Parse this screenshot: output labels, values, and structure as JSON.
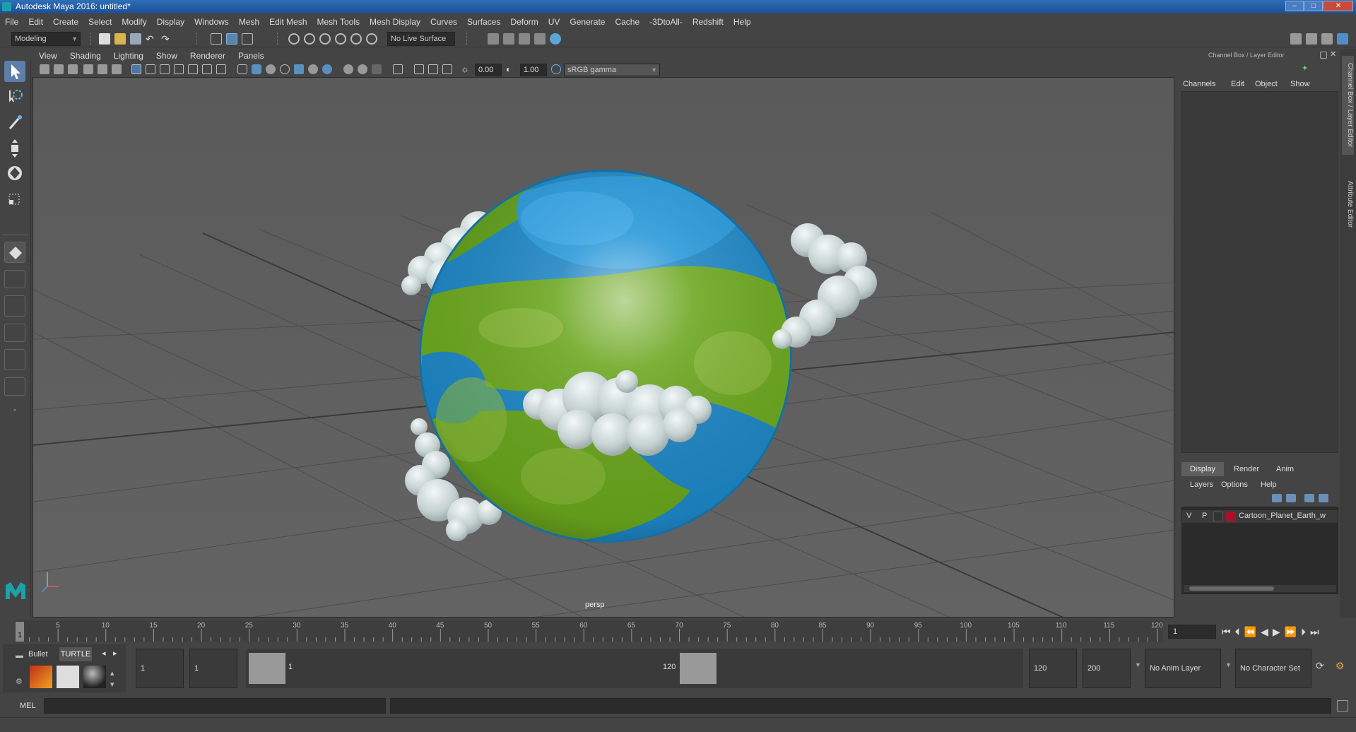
{
  "window": {
    "title": "Autodesk Maya 2016: untitled*",
    "min": "–",
    "max": "□",
    "close": "✕"
  },
  "menus": [
    "File",
    "Edit",
    "Create",
    "Select",
    "Modify",
    "Display",
    "Windows",
    "Mesh",
    "Edit Mesh",
    "Mesh Tools",
    "Mesh Display",
    "Curves",
    "Surfaces",
    "Deform",
    "UV",
    "Generate",
    "Cache",
    "-3DtoAll-",
    "Redshift",
    "Help"
  ],
  "status_line": {
    "mode": "Modeling",
    "live_surface": "No Live Surface"
  },
  "panel": {
    "menus": [
      "View",
      "Shading",
      "Lighting",
      "Show",
      "Renderer",
      "Panels"
    ],
    "exposure": "0.00",
    "gamma": "1.00",
    "color_space": "sRGB gamma",
    "camera": "persp"
  },
  "channel_box": {
    "title": "Channel Box / Layer Editor",
    "menus": [
      "Channels",
      "Edit",
      "Object",
      "Show"
    ],
    "layer_tabs": [
      "Display",
      "Render",
      "Anim"
    ],
    "layer_menus": [
      "Layers",
      "Options",
      "Help"
    ],
    "layer": {
      "v": "V",
      "p": "P",
      "name": "Cartoon_Planet_Earth_w",
      "color": "#a8102a"
    }
  },
  "side_tabs": [
    "Channel Box / Layer Editor",
    "Attribute Editor"
  ],
  "timeline": {
    "ticks": [
      "5",
      "10",
      "15",
      "20",
      "25",
      "30",
      "35",
      "40",
      "45",
      "50",
      "55",
      "60",
      "65",
      "70",
      "75",
      "80",
      "85",
      "90",
      "95",
      "100",
      "105",
      "110",
      "115",
      "120"
    ],
    "current_frame_marker": "1",
    "current_frame": "1"
  },
  "range": {
    "start": "1",
    "playback_start": "1",
    "slider_start": "1",
    "slider_end": "120",
    "playback_end": "120",
    "end": "200",
    "anim_layer": "No Anim Layer",
    "character_set": "No Character Set"
  },
  "shelf": {
    "tabs": [
      "Bullet",
      "TURTLE"
    ]
  },
  "command_line": {
    "lang": "MEL"
  },
  "colors": {
    "ui_bg": "#444444",
    "viewport_bg": "#5e5e5e",
    "title_bar": "#2d6fb8",
    "land": "#6aa41c",
    "ocean": "#1e7cc0",
    "cloud": "#c8d4d4"
  }
}
